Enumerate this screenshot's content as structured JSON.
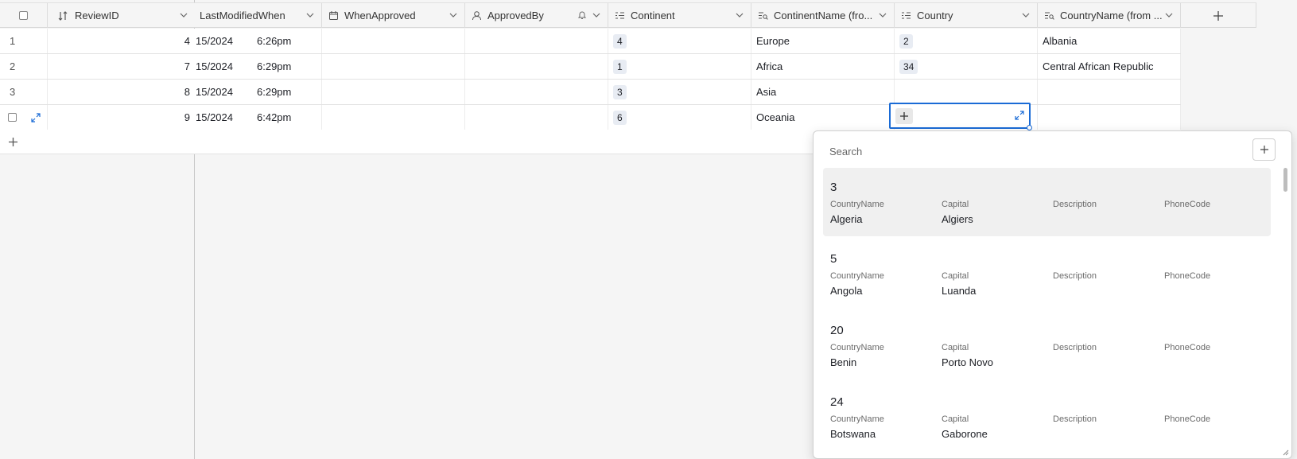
{
  "columns": {
    "review_id": "ReviewID",
    "last_modified": "LastModifiedWhen",
    "when_approved": "WhenApproved",
    "approved_by": "ApprovedBy",
    "continent": "Continent",
    "continent_name": "ContinentName (fro...",
    "country": "Country",
    "country_name": "CountryName (from ..."
  },
  "rows": [
    {
      "index": "1",
      "review_id": "4",
      "date": "15/2024",
      "time": "6:26pm",
      "continent": "4",
      "continent_name": "Europe",
      "country": "2",
      "country_name": "Albania"
    },
    {
      "index": "2",
      "review_id": "7",
      "date": "15/2024",
      "time": "6:29pm",
      "continent": "1",
      "continent_name": "Africa",
      "country": "34",
      "country_name": "Central African Republic"
    },
    {
      "index": "3",
      "review_id": "8",
      "date": "15/2024",
      "time": "6:29pm",
      "continent": "3",
      "continent_name": "Asia",
      "country": "",
      "country_name": ""
    },
    {
      "index": "",
      "review_id": "9",
      "date": "15/2024",
      "time": "6:42pm",
      "continent": "6",
      "continent_name": "Oceania",
      "country": "",
      "country_name": ""
    }
  ],
  "popup": {
    "search_placeholder": "Search",
    "labels": {
      "country_name": "CountryName",
      "capital": "Capital",
      "description": "Description",
      "phone_code": "PhoneCode"
    },
    "records": [
      {
        "id": "3",
        "country_name": "Algeria",
        "capital": "Algiers"
      },
      {
        "id": "5",
        "country_name": "Angola",
        "capital": "Luanda"
      },
      {
        "id": "20",
        "country_name": "Benin",
        "capital": "Porto Novo"
      },
      {
        "id": "24",
        "country_name": "Botswana",
        "capital": "Gaborone"
      }
    ]
  },
  "colors": {
    "accent": "#1a6bd6",
    "chip_bg": "#e8ecf3"
  }
}
